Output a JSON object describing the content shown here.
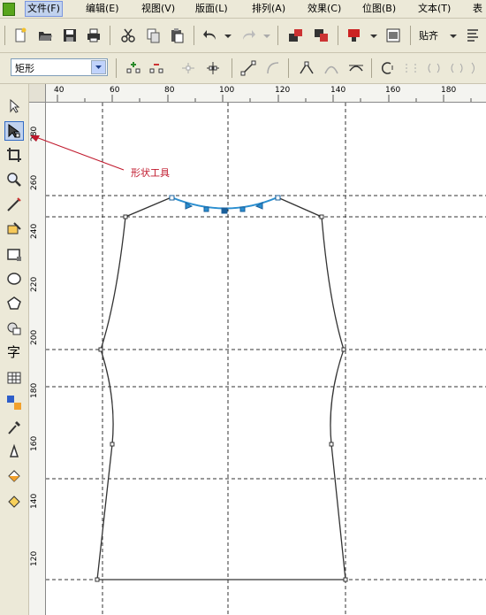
{
  "menu": {
    "items": [
      "文件(F)",
      "编辑(E)",
      "视图(V)",
      "版面(L)",
      "排列(A)",
      "效果(C)",
      "位图(B)",
      "文本(T)",
      "表"
    ]
  },
  "toolbar": {
    "paste_label": "贴齐",
    "shape_select_value": "矩形"
  },
  "ruler": {
    "horizontal_labels": [
      "40",
      "60",
      "80",
      "100",
      "120",
      "140",
      "160",
      "180"
    ],
    "vertical_labels": [
      "280",
      "260",
      "240",
      "220",
      "200",
      "180",
      "160",
      "140",
      "120"
    ]
  },
  "annotation": {
    "text": "形状工具",
    "color": "#c0182c"
  },
  "toolbox": {
    "tools": [
      "pick-tool",
      "shape-tool",
      "crop-tool",
      "zoom-tool",
      "freehand-tool",
      "smart-fill-tool",
      "rectangle-tool",
      "ellipse-tool",
      "polygon-tool",
      "basic-shapes-tool",
      "text-tool",
      "table-tool",
      "interactive-blend-tool",
      "eyedropper-tool",
      "outline-tool",
      "fill-tool",
      "interactive-fill-tool"
    ]
  }
}
